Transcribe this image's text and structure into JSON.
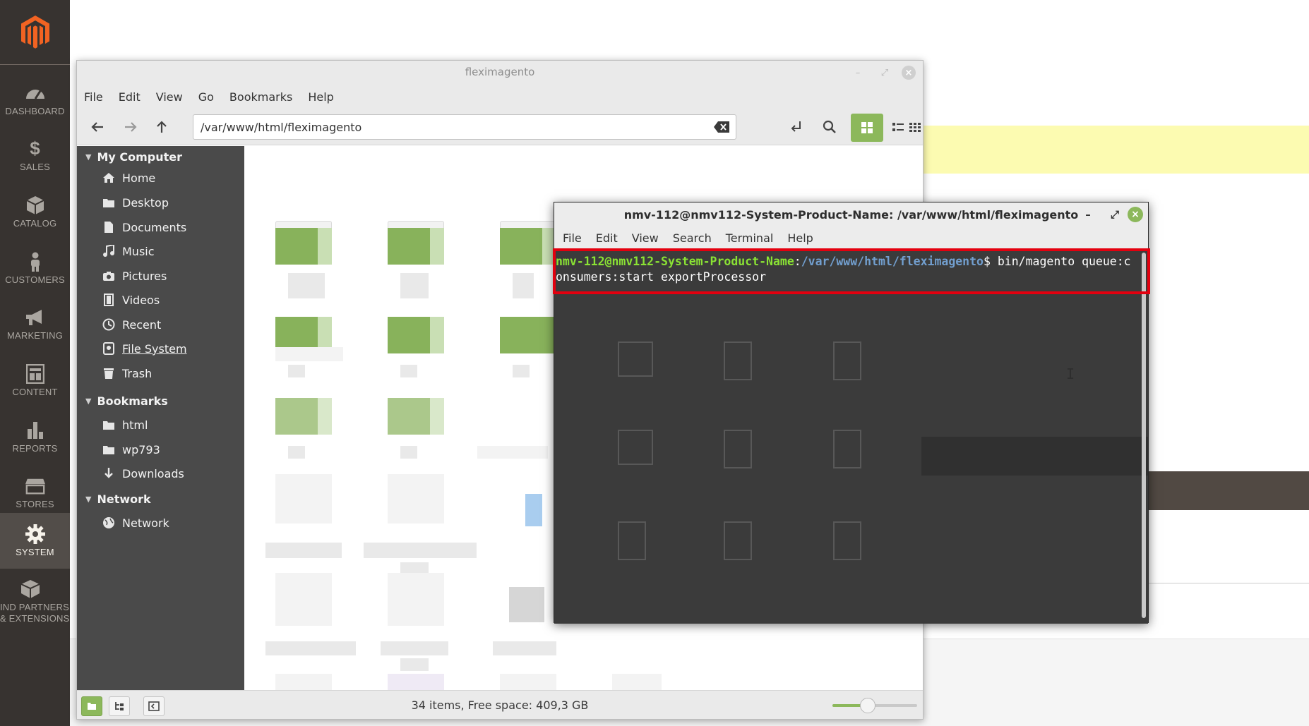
{
  "magento_sidebar": {
    "logo": "magento-logo",
    "items": [
      {
        "label": "DASHBOARD",
        "icon": "speedometer-icon"
      },
      {
        "label": "SALES",
        "icon": "dollar-icon"
      },
      {
        "label": "CATALOG",
        "icon": "box-icon"
      },
      {
        "label": "CUSTOMERS",
        "icon": "person-icon"
      },
      {
        "label": "MARKETING",
        "icon": "megaphone-icon"
      },
      {
        "label": "CONTENT",
        "icon": "layout-icon"
      },
      {
        "label": "REPORTS",
        "icon": "bar-chart-icon"
      },
      {
        "label": "STORES",
        "icon": "storefront-icon"
      },
      {
        "label": "SYSTEM",
        "icon": "gear-icon",
        "active": true
      },
      {
        "label": "FIND PARTNERS & EXTENSIONS",
        "label_line1": "IND PARTNERS",
        "label_line2": "& EXTENSIONS",
        "icon": "cubes-icon"
      }
    ]
  },
  "file_manager": {
    "title": "fleximagento",
    "menu": [
      "File",
      "Edit",
      "View",
      "Go",
      "Bookmarks",
      "Help"
    ],
    "location": "/var/www/html/fleximagento",
    "sidebar": {
      "my_computer": {
        "header": "My Computer",
        "items": [
          "Home",
          "Desktop",
          "Documents",
          "Music",
          "Pictures",
          "Videos",
          "Recent",
          "File System",
          "Trash"
        ]
      },
      "bookmarks": {
        "header": "Bookmarks",
        "items": [
          "html",
          "wp793",
          "Downloads"
        ]
      },
      "network": {
        "header": "Network",
        "items": [
          "Network"
        ]
      }
    },
    "status_text": "34 items, Free space: 409,3 GB",
    "zoom_level": 0.42,
    "accent_color": "#8cb85b"
  },
  "terminal": {
    "title": "nmv-112@nmv112-System-Product-Name: /var/www/html/fleximagento",
    "menu": [
      "File",
      "Edit",
      "View",
      "Search",
      "Terminal",
      "Help"
    ],
    "prompt_user": "nmv-112@nmv112-System-Product-Name",
    "prompt_sep": ":",
    "prompt_path": "/var/www/html/fleximagento",
    "prompt_symbol": "$ ",
    "command": "bin/magento queue:consumers:start exportProcessor",
    "highlight_color": "#e3000f"
  }
}
